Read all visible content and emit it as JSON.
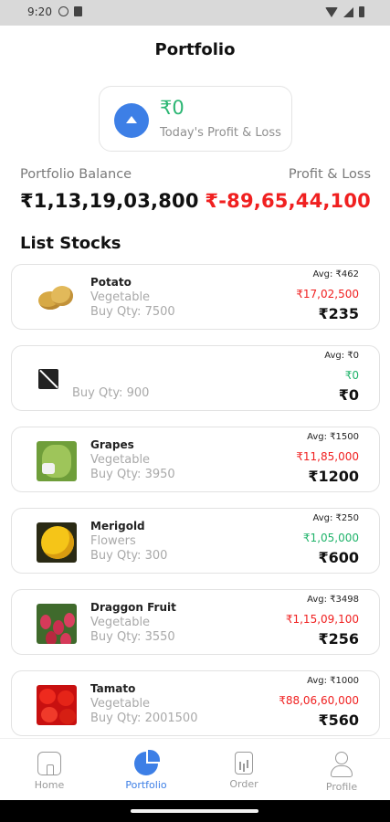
{
  "status_bar": {
    "time": "9:20"
  },
  "header": {
    "title": "Portfolio"
  },
  "today": {
    "value": "₹0",
    "label": "Today's Profit & Loss",
    "trend": "up"
  },
  "summary": {
    "balance_label": "Portfolio Balance",
    "balance_value": "₹1,13,19,03,800",
    "pl_label": "Profit & Loss",
    "pl_value": "₹-89,65,44,100"
  },
  "list": {
    "title": "List Stocks",
    "items": [
      {
        "name": "Potato",
        "category": "Vegetable",
        "qty": "Buy Qty: 7500",
        "avg": "Avg: ₹462",
        "pl": "₹17,02,500",
        "pl_sign": "neg",
        "price": "₹235",
        "image": "potato"
      },
      {
        "name": "",
        "category": "",
        "qty": "Buy Qty: 900",
        "avg": "Avg: ₹0",
        "pl": "₹0",
        "pl_sign": "pos",
        "price": "₹0",
        "image": "no-image"
      },
      {
        "name": "Grapes",
        "category": "Vegetable",
        "qty": "Buy Qty: 3950",
        "avg": "Avg: ₹1500",
        "pl": "₹11,85,000",
        "pl_sign": "neg",
        "price": "₹1200",
        "image": "grapes"
      },
      {
        "name": "Merigold",
        "category": "Flowers",
        "qty": "Buy Qty: 300",
        "avg": "Avg: ₹250",
        "pl": "₹1,05,000",
        "pl_sign": "pos",
        "price": "₹600",
        "image": "marigold"
      },
      {
        "name": "Draggon Fruit",
        "category": "Vegetable",
        "qty": "Buy Qty: 3550",
        "avg": "Avg: ₹3498",
        "pl": "₹1,15,09,100",
        "pl_sign": "neg",
        "price": "₹256",
        "image": "dragon-fruit"
      },
      {
        "name": "Tamato",
        "category": "Vegetable",
        "qty": "Buy Qty: 2001500",
        "avg": "Avg: ₹1000",
        "pl": "₹88,06,60,000",
        "pl_sign": "neg",
        "price": "₹560",
        "image": "tomato"
      }
    ]
  },
  "nav": {
    "items": [
      {
        "label": "Home",
        "icon": "home-icon"
      },
      {
        "label": "Portfolio",
        "icon": "pie-chart-icon",
        "active": true
      },
      {
        "label": "Order",
        "icon": "order-icon"
      },
      {
        "label": "Profile",
        "icon": "profile-icon"
      }
    ]
  },
  "colors": {
    "accent": "#3d7fe6",
    "positive": "#2bb673",
    "negative": "#f02020"
  }
}
